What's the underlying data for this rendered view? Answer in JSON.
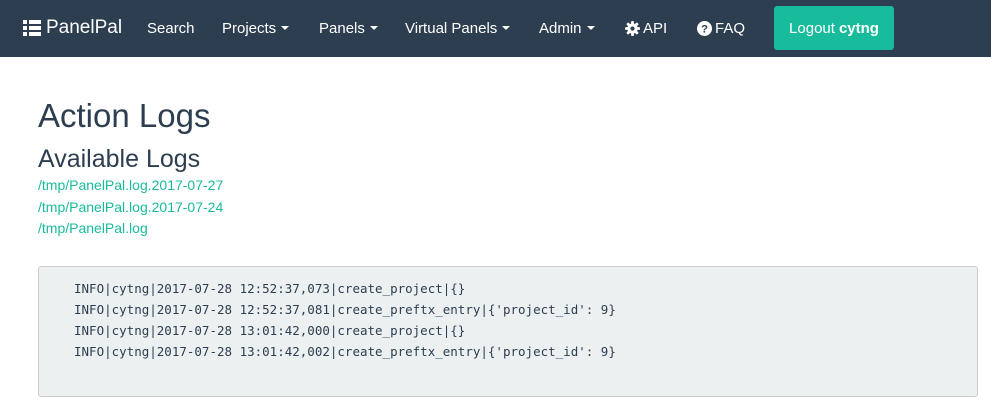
{
  "navbar": {
    "brand": "PanelPal",
    "items": [
      {
        "label": "Search"
      },
      {
        "label": "Projects"
      },
      {
        "label": "Panels"
      },
      {
        "label": "Virtual Panels"
      },
      {
        "label": "Admin"
      },
      {
        "label": "API"
      },
      {
        "label": "FAQ"
      }
    ],
    "logout_prefix": "Logout",
    "logout_user": "cytng"
  },
  "main": {
    "title": "Action Logs",
    "subtitle": "Available Logs",
    "log_files": [
      "/tmp/PanelPal.log.2017-07-27",
      "/tmp/PanelPal.log.2017-07-24",
      "/tmp/PanelPal.log"
    ],
    "log_entries": [
      "INFO|cytng|2017-07-28 12:52:37,073|create_project|{}",
      "INFO|cytng|2017-07-28 12:52:37,081|create_preftx_entry|{'project_id': 9}",
      "INFO|cytng|2017-07-28 13:01:42,000|create_project|{}",
      "INFO|cytng|2017-07-28 13:01:42,002|create_preftx_entry|{'project_id': 9}"
    ]
  },
  "colors": {
    "navbar_bg": "#2c3e50",
    "accent": "#18bc9c",
    "log_bg": "#ecf0f1"
  },
  "icons": {
    "brand": "list-icon",
    "api": "gear-icon",
    "faq": "question-circle-icon",
    "dropdown": "caret-down-icon"
  }
}
